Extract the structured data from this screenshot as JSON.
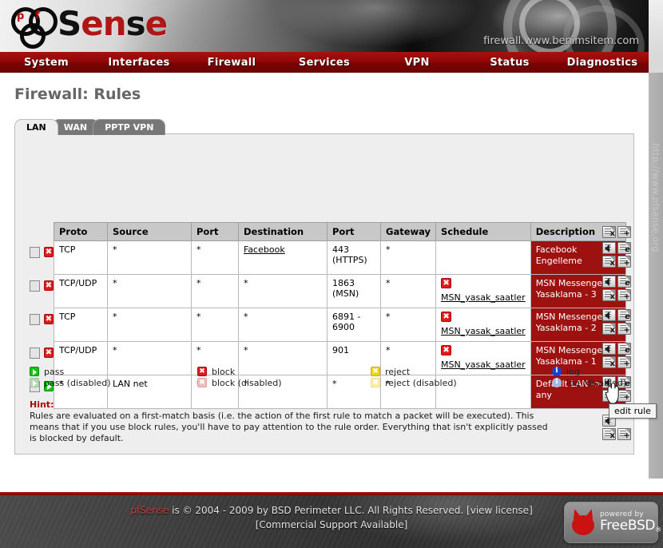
{
  "header": {
    "logo_text_1": "Sense",
    "logo_badge_p": "p",
    "logo_badge_f": "f",
    "hostname": "firewall.www.benimsitem.com"
  },
  "nav": {
    "items": [
      {
        "label": "System"
      },
      {
        "label": "Interfaces"
      },
      {
        "label": "Firewall"
      },
      {
        "label": "Services"
      },
      {
        "label": "VPN"
      },
      {
        "label": "Status"
      },
      {
        "label": "Diagnostics"
      }
    ]
  },
  "rail": {
    "watermark": "http://www.pfsense.org"
  },
  "page": {
    "title": "Firewall: Rules"
  },
  "tabs": [
    {
      "label": "LAN",
      "active": true
    },
    {
      "label": "WAN",
      "active": false
    },
    {
      "label": "PPTP VPN",
      "active": false
    }
  ],
  "table": {
    "columns": [
      "Proto",
      "Source",
      "Port",
      "Destination",
      "Port",
      "Gateway",
      "Schedule",
      "Description"
    ],
    "rows": [
      {
        "status": "block",
        "proto": "TCP",
        "source": "*",
        "port": "*",
        "destination": "Facebook",
        "destination_link": true,
        "dest_port": "443 (HTTPS)",
        "gateway": "*",
        "schedule": "",
        "schedule_icon": "",
        "description": "Facebook Engelleme"
      },
      {
        "status": "block",
        "proto": "TCP/UDP",
        "source": "*",
        "port": "*",
        "destination": "*",
        "destination_link": false,
        "dest_port": "1863 (MSN)",
        "gateway": "*",
        "schedule": "MSN_yasak_saatler",
        "schedule_icon": "block",
        "description": "MSN Messenger Yasaklama - 3"
      },
      {
        "status": "block",
        "proto": "TCP",
        "source": "*",
        "port": "*",
        "destination": "*",
        "destination_link": false,
        "dest_port": "6891 - 6900",
        "gateway": "*",
        "schedule": "MSN_yasak_saatler",
        "schedule_icon": "block",
        "description": "MSN Messenger Yasaklama - 2"
      },
      {
        "status": "block",
        "proto": "TCP/UDP",
        "source": "*",
        "port": "*",
        "destination": "*",
        "destination_link": false,
        "dest_port": "901",
        "gateway": "*",
        "schedule": "MSN_yasak_saatler",
        "schedule_icon": "block",
        "description": "MSN Messenger Yasaklama - 1"
      },
      {
        "status": "pass",
        "proto": "*",
        "source": "LAN net",
        "port": "*",
        "destination": "*",
        "destination_link": false,
        "dest_port": "*",
        "gateway": "*",
        "schedule": "",
        "schedule_icon": "",
        "description": "Default LAN -> any"
      }
    ]
  },
  "actions": {
    "delete_selected_label": "x",
    "add_new_label": "+",
    "move_label": "◀",
    "edit_label": "e",
    "delete_label": "x",
    "add_label": "+"
  },
  "tooltip": {
    "text": "edit rule"
  },
  "legend": {
    "col1": [
      {
        "kind": "pass",
        "label": "pass"
      },
      {
        "kind": "pass-disabled",
        "label": "pass (disabled)"
      }
    ],
    "col2": [
      {
        "kind": "block",
        "label": "block"
      },
      {
        "kind": "block-disabled",
        "label": "block (disabled)"
      }
    ],
    "col3": [
      {
        "kind": "reject",
        "label": "reject"
      },
      {
        "kind": "reject-disabled",
        "label": "reject (disabled)"
      }
    ],
    "col4": [
      {
        "kind": "log",
        "label": "log"
      },
      {
        "kind": "log-disabled",
        "label": "log (disabled)"
      }
    ]
  },
  "hint": {
    "label": "Hint:",
    "text": "Rules are evaluated on a first-match basis (i.e. the action of the first rule to match a packet will be executed). This means that if you use block rules, you'll have to pay attention to the rule order. Everything that isn't explicitly passed is blocked by default."
  },
  "footer": {
    "brand": "pfSense",
    "line1_rest": " is © 2004 - 2009 by BSD Perimeter LLC. All Rights Reserved. ",
    "view_license": "[view license]",
    "line2": "[Commercial Support Available]",
    "powered_by": "powered by",
    "freebsd": "FreeBSD",
    "freebsd_reg": "®"
  },
  "colors": {
    "nav_red": "#900707",
    "desc_red": "#9d1111",
    "title_gray": "#666666",
    "hint_red": "#b00000"
  }
}
